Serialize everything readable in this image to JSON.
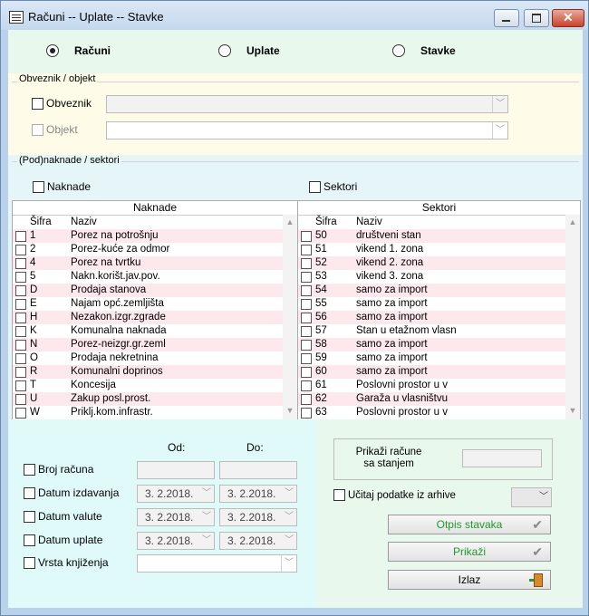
{
  "window": {
    "title": "Računi -- Uplate -- Stavke"
  },
  "mode": {
    "options": [
      {
        "label": "Računi",
        "selected": true
      },
      {
        "label": "Uplate",
        "selected": false
      },
      {
        "label": "Stavke",
        "selected": false
      }
    ]
  },
  "obveznik_group": {
    "title": "Obveznik / objekt",
    "obveznik_label": "Obveznik",
    "objekt_label": "Objekt"
  },
  "naknade_group": {
    "title": "(Pod)naknade / sektori",
    "naknade_check": "Naknade",
    "sektori_check": "Sektori"
  },
  "naknade_grid": {
    "header": "Naknade",
    "col_code": "Šifra",
    "col_name": "Naziv",
    "rows": [
      [
        "1",
        "Porez na potrošnju"
      ],
      [
        "2",
        "Porez-kuće za odmor"
      ],
      [
        "4",
        "Porez na tvrtku"
      ],
      [
        "5",
        "Nakn.korišt.jav.pov."
      ],
      [
        "D",
        "Prodaja stanova"
      ],
      [
        "E",
        "Najam opć.zemljišta"
      ],
      [
        "H",
        "Nezakon.izgr.zgrade"
      ],
      [
        "K",
        "Komunalna naknada"
      ],
      [
        "N",
        "Porez-neizgr.gr.zeml"
      ],
      [
        "O",
        "Prodaja nekretnina"
      ],
      [
        "R",
        "Komunalni doprinos"
      ],
      [
        "T",
        "Koncesija"
      ],
      [
        "U",
        "Zakup posl.prost."
      ],
      [
        "W",
        "Priklj.kom.infrastr."
      ]
    ]
  },
  "sektori_grid": {
    "header": "Sektori",
    "col_code": "Šifra",
    "col_name": "Naziv",
    "rows": [
      [
        "50",
        "društveni stan"
      ],
      [
        "51",
        "vikend 1. zona"
      ],
      [
        "52",
        "vikend 2. zona"
      ],
      [
        "53",
        "vikend 3. zona"
      ],
      [
        "54",
        "samo za import"
      ],
      [
        "55",
        "samo za import"
      ],
      [
        "56",
        "samo za import"
      ],
      [
        "57",
        "Stan u etažnom vlasn"
      ],
      [
        "58",
        "samo za import"
      ],
      [
        "59",
        "samo za import"
      ],
      [
        "60",
        "samo za import"
      ],
      [
        "61",
        "Poslovni prostor u v"
      ],
      [
        "62",
        "Garaža u vlasništvu"
      ],
      [
        "63",
        "Poslovni prostor u v"
      ]
    ]
  },
  "filters": {
    "od_label": "Od:",
    "do_label": "Do:",
    "broj_racuna": "Broj računa",
    "datum_izdavanja": "Datum izdavanja",
    "datum_valute": "Datum valute",
    "datum_uplate": "Datum uplate",
    "vrsta_knjizenja": "Vrsta knjiženja",
    "date_value": "3. 2.2018."
  },
  "right_panel": {
    "prikazi_racune": "Prikaži račune\nsa stanjem",
    "ucitaj_arhive": "Učitaj podatke iz arhive",
    "otpis_button": "Otpis stavaka",
    "prikazi_button": "Prikaži",
    "izlaz_button": "Izlaz",
    "accent_green": "#1c9a2a"
  }
}
